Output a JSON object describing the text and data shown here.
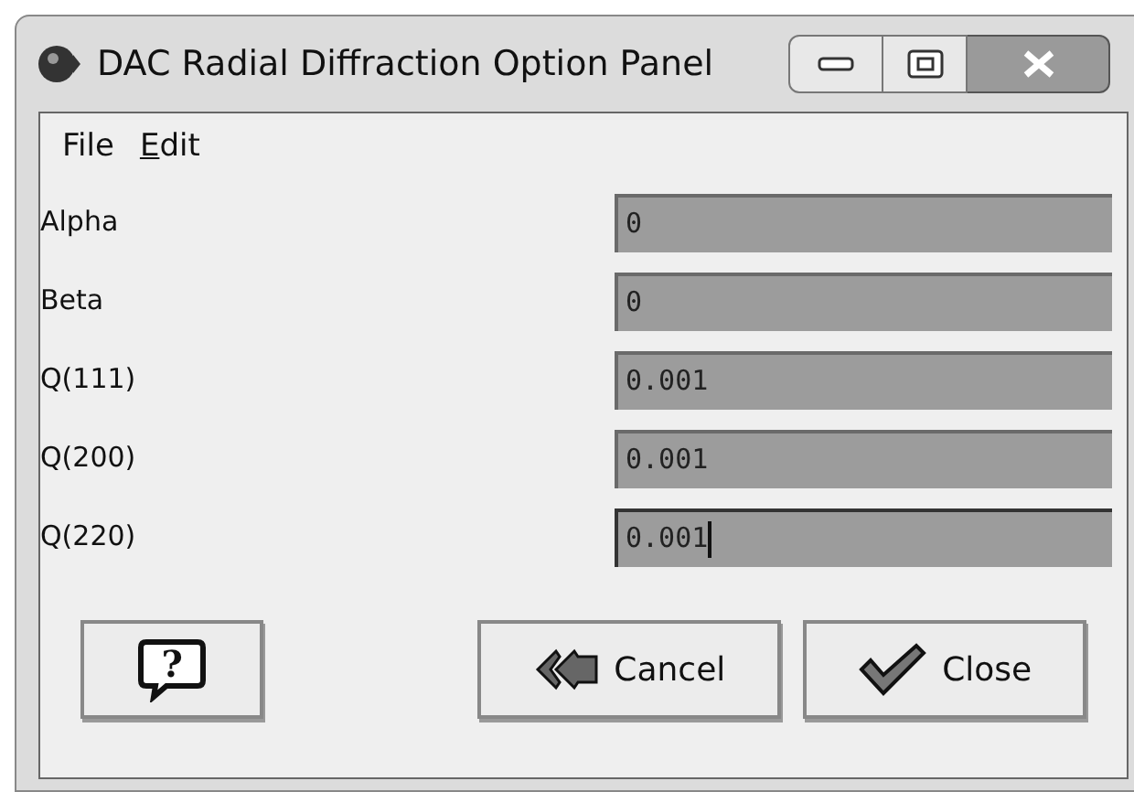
{
  "window": {
    "title": "DAC Radial Diffraction Option Panel"
  },
  "menu": [
    {
      "label": "File",
      "mnemonic": false
    },
    {
      "label": "Edit",
      "mnemonic": true
    }
  ],
  "fields": [
    {
      "label": "Alpha",
      "value": "0",
      "focused": false
    },
    {
      "label": "Beta",
      "value": "0",
      "focused": false
    },
    {
      "label": "Q(111)",
      "value": "0.001",
      "focused": false
    },
    {
      "label": "Q(200)",
      "value": "0.001",
      "focused": false
    },
    {
      "label": "Q(220)",
      "value": "0.001",
      "focused": true
    }
  ],
  "buttons": [
    {
      "kind": "help",
      "label": "?"
    },
    {
      "kind": "cancel",
      "label": "Cancel"
    },
    {
      "kind": "close",
      "label": "Close"
    }
  ]
}
